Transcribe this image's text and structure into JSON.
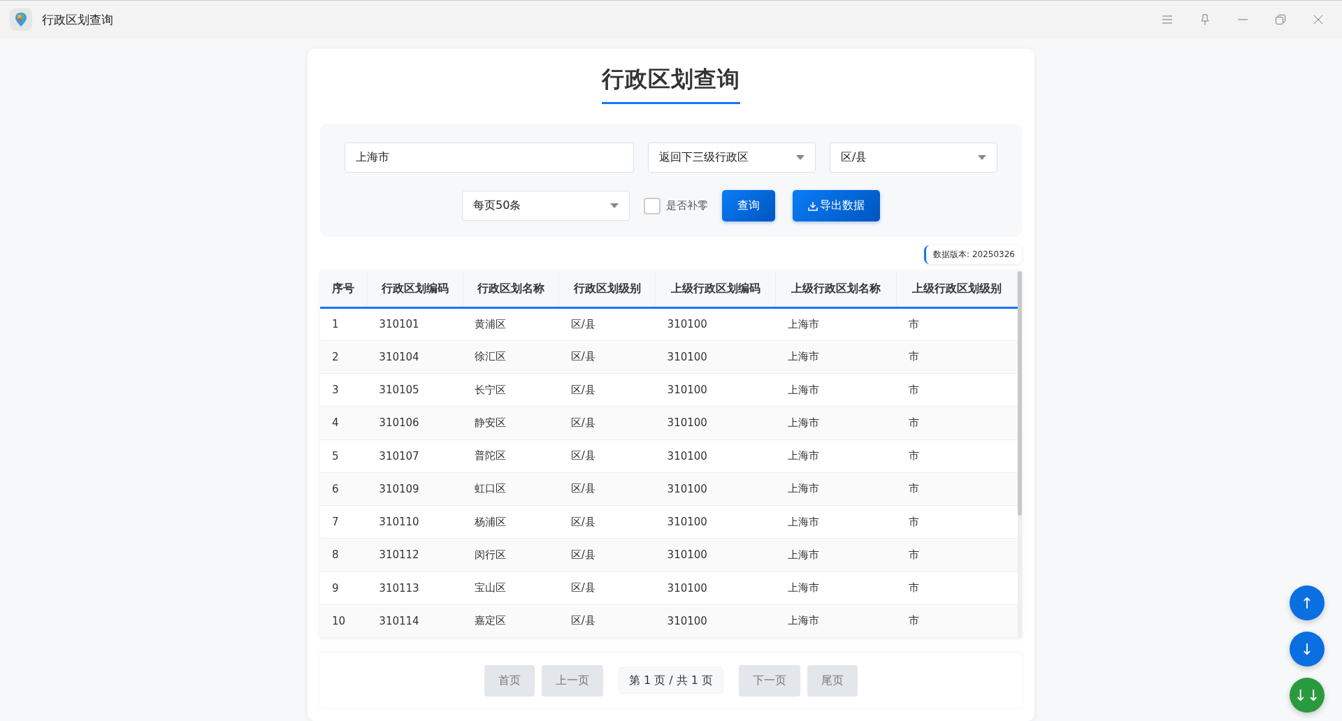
{
  "window": {
    "title": "行政区划查询"
  },
  "heading": "行政区划查询",
  "filters": {
    "keyword": {
      "value": "上海市"
    },
    "scope": {
      "value": "返回下三级行政区"
    },
    "level": {
      "value": "区/县"
    },
    "page_size": {
      "value": "每页50条"
    },
    "zero_pad": {
      "label": "是否补零",
      "checked": false
    },
    "query_button": "查询",
    "export_button": "导出数据"
  },
  "data_version": "数据版本: 20250326",
  "table": {
    "columns": [
      "序号",
      "行政区划编码",
      "行政区划名称",
      "行政区划级别",
      "上级行政区划编码",
      "上级行政区划名称",
      "上级行政区划级别"
    ],
    "rows": [
      [
        "1",
        "310101",
        "黄浦区",
        "区/县",
        "310100",
        "上海市",
        "市"
      ],
      [
        "2",
        "310104",
        "徐汇区",
        "区/县",
        "310100",
        "上海市",
        "市"
      ],
      [
        "3",
        "310105",
        "长宁区",
        "区/县",
        "310100",
        "上海市",
        "市"
      ],
      [
        "4",
        "310106",
        "静安区",
        "区/县",
        "310100",
        "上海市",
        "市"
      ],
      [
        "5",
        "310107",
        "普陀区",
        "区/县",
        "310100",
        "上海市",
        "市"
      ],
      [
        "6",
        "310109",
        "虹口区",
        "区/县",
        "310100",
        "上海市",
        "市"
      ],
      [
        "7",
        "310110",
        "杨浦区",
        "区/县",
        "310100",
        "上海市",
        "市"
      ],
      [
        "8",
        "310112",
        "闵行区",
        "区/县",
        "310100",
        "上海市",
        "市"
      ],
      [
        "9",
        "310113",
        "宝山区",
        "区/县",
        "310100",
        "上海市",
        "市"
      ],
      [
        "10",
        "310114",
        "嘉定区",
        "区/县",
        "310100",
        "上海市",
        "市"
      ]
    ]
  },
  "pagination": {
    "buttons": [
      {
        "label": "首页",
        "disabled": true
      },
      {
        "label": "上一页",
        "disabled": true
      },
      {
        "kind": "info",
        "label": "第 1 页 / 共 1 页"
      },
      {
        "label": "下一页",
        "disabled": true
      },
      {
        "label": "尾页",
        "disabled": true
      }
    ]
  },
  "float_buttons": [
    {
      "label": "↑",
      "color": "#0a6fe0"
    },
    {
      "label": "↓",
      "color": "#0a6fe0"
    },
    {
      "label": "↓↓",
      "color": "#2a9a3e"
    }
  ]
}
